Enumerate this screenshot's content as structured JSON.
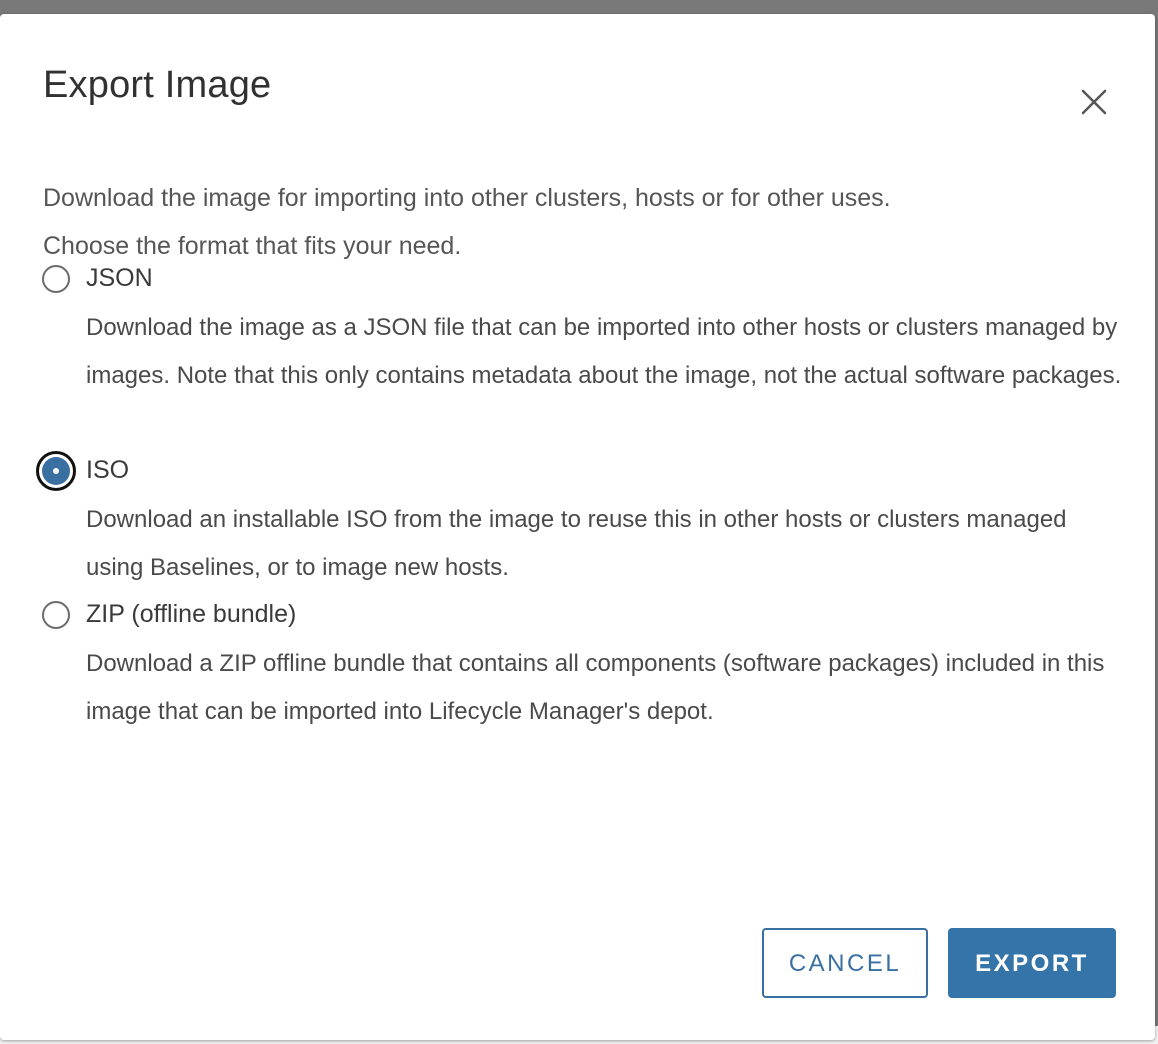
{
  "dialog": {
    "title": "Export Image",
    "close_icon": "close-icon",
    "intro_line1": "Download the image for importing into other clusters, hosts or for other uses.",
    "intro_line2": "Choose the format that fits your need.",
    "options": [
      {
        "label": "JSON",
        "selected": false,
        "description": "Download the image as a JSON file that can be imported into other hosts or clusters managed by images. Note that this only contains metadata about the image, not the actual software packages."
      },
      {
        "label": "ISO",
        "selected": true,
        "description": "Download an installable ISO from the image to reuse this in other hosts or clusters managed using Baselines, or to image new hosts."
      },
      {
        "label": "ZIP (offline bundle)",
        "selected": false,
        "description": "Download a ZIP offline bundle that contains all components (software packages) included in this image that can be imported into Lifecycle Manager's depot."
      }
    ],
    "buttons": {
      "cancel": "CANCEL",
      "export": "EXPORT"
    },
    "colors": {
      "accent": "#3474a8",
      "overlay": "#787878"
    }
  }
}
